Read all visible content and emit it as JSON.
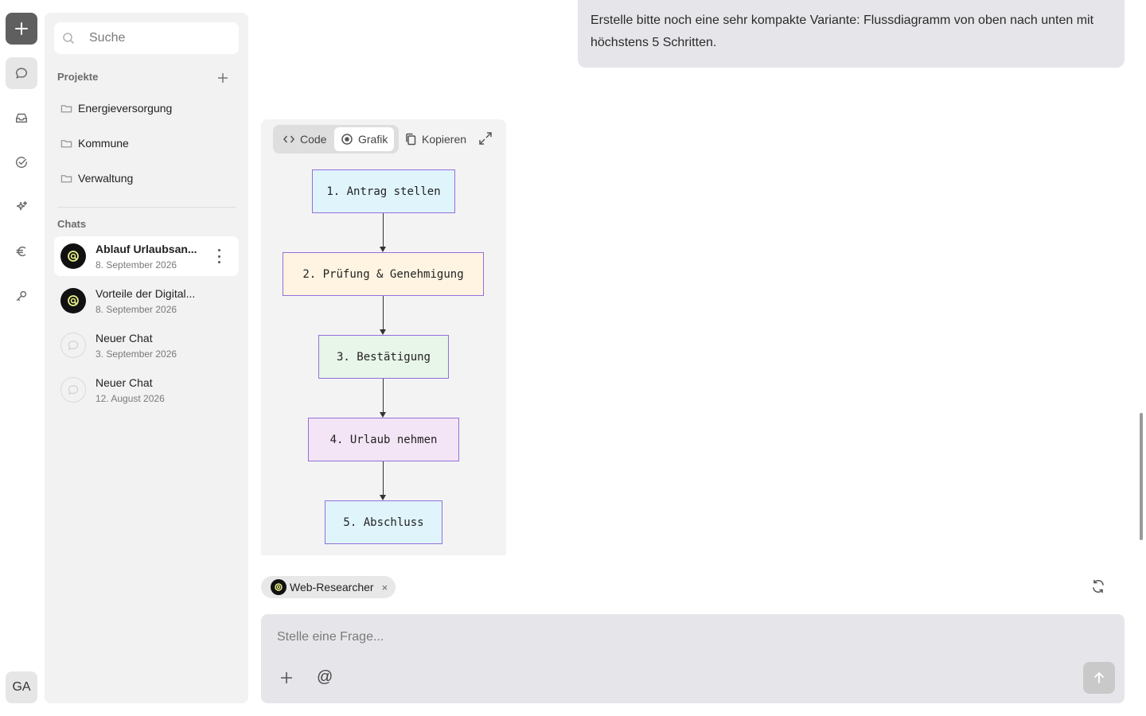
{
  "rail": {
    "items": [
      {
        "name": "new-chat",
        "icon": "plus-icon"
      },
      {
        "name": "chats",
        "icon": "chat-bubble-icon"
      },
      {
        "name": "inbox",
        "icon": "inbox-icon"
      },
      {
        "name": "tasks",
        "icon": "check-circle-icon"
      },
      {
        "name": "assistants",
        "icon": "sparkles-icon"
      },
      {
        "name": "costs",
        "icon": "euro-icon"
      },
      {
        "name": "keys",
        "icon": "key-icon"
      }
    ],
    "user_initials": "GA"
  },
  "sidebar": {
    "search_placeholder": "Suche",
    "projects_title": "Projekte",
    "projects": [
      {
        "label": "Energieversorgung"
      },
      {
        "label": "Kommune"
      },
      {
        "label": "Verwaltung"
      }
    ],
    "chats_title": "Chats",
    "chats": [
      {
        "title": "Ablauf Urlaubsan...",
        "date": "8. September 2026",
        "active": true,
        "avatar": "agent"
      },
      {
        "title": "Vorteile der Digital...",
        "date": "8. September 2026",
        "active": false,
        "avatar": "agent"
      },
      {
        "title": "Neuer Chat",
        "date": "3. September 2026",
        "active": false,
        "avatar": "empty"
      },
      {
        "title": "Neuer Chat",
        "date": "12. August 2026",
        "active": false,
        "avatar": "empty"
      }
    ]
  },
  "conversation": {
    "user_message": "Erstelle bitte noch eine sehr kompakte Variante: Flussdiagramm von oben nach unten mit höchstens 5 Schritten."
  },
  "diagram": {
    "tabs": {
      "code": "Code",
      "grafik": "Grafik",
      "active": "Grafik"
    },
    "copy_label": "Kopieren",
    "nodes": [
      {
        "label": "1. Antrag stellen",
        "fill": "#e0f4fc"
      },
      {
        "label": "2. Prüfung & Genehmigung",
        "fill": "#fff4e2"
      },
      {
        "label": "3. Bestätigung",
        "fill": "#e8f5e9"
      },
      {
        "label": "4. Urlaub nehmen",
        "fill": "#f3e5f5"
      },
      {
        "label": "5. Abschluss",
        "fill": "#e0f4fc"
      }
    ],
    "node_border_color": "#9370db"
  },
  "composer": {
    "agent_chip": "Web-Researcher",
    "agent_chip_remove": "×",
    "placeholder": "Stelle eine Frage...",
    "mention_symbol": "@"
  }
}
